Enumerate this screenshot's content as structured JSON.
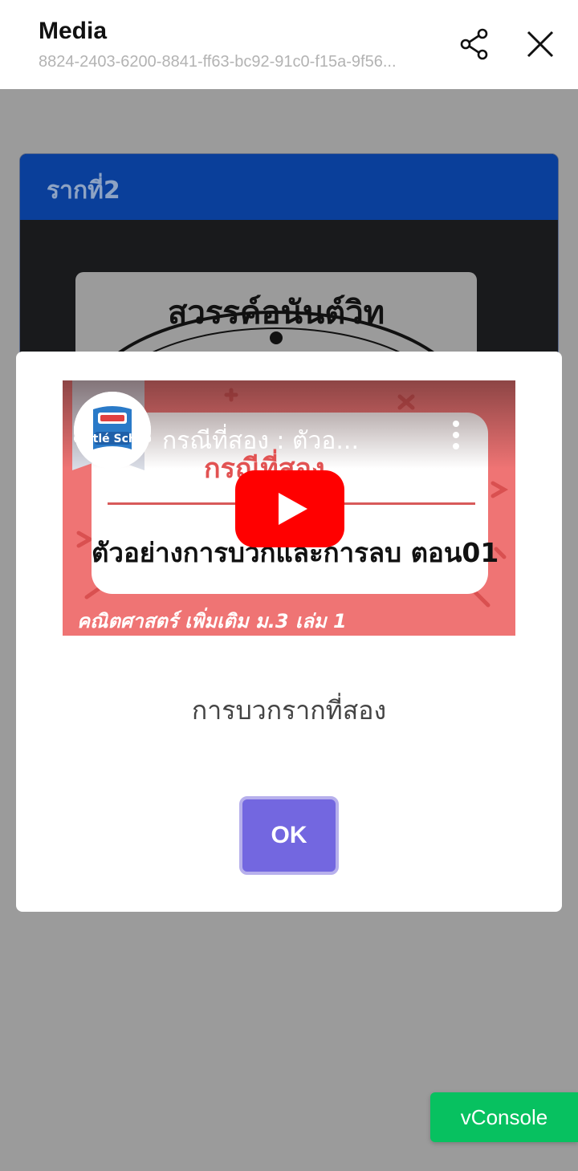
{
  "header": {
    "title": "Media",
    "subtitle": "8824-2403-6200-8841-ff63-bc92-91c0-f15a-9f56..."
  },
  "background_card": {
    "title": "รากที่2",
    "image_text": "สวรรค์อนันต์วิท"
  },
  "video": {
    "title": "กรณีที่สอง : ตัวอ...",
    "channel": "Nestlé School",
    "thumbnail_heading": "กรณีที่สอง",
    "thumbnail_subtitle": "ตัวอย่างการบวกและการลบ ตอน01",
    "thumbnail_footer": "คณิตศาสตร์ เพิ่มเติม ม.3 เล่ม 1"
  },
  "modal": {
    "caption": "การบวกรากที่สอง",
    "ok_label": "OK"
  },
  "vconsole": {
    "label": "vConsole"
  },
  "colors": {
    "card_header": "#0a3f9a",
    "ok_button": "#7367e0",
    "vconsole": "#07c160",
    "youtube_red": "#ff0000"
  }
}
